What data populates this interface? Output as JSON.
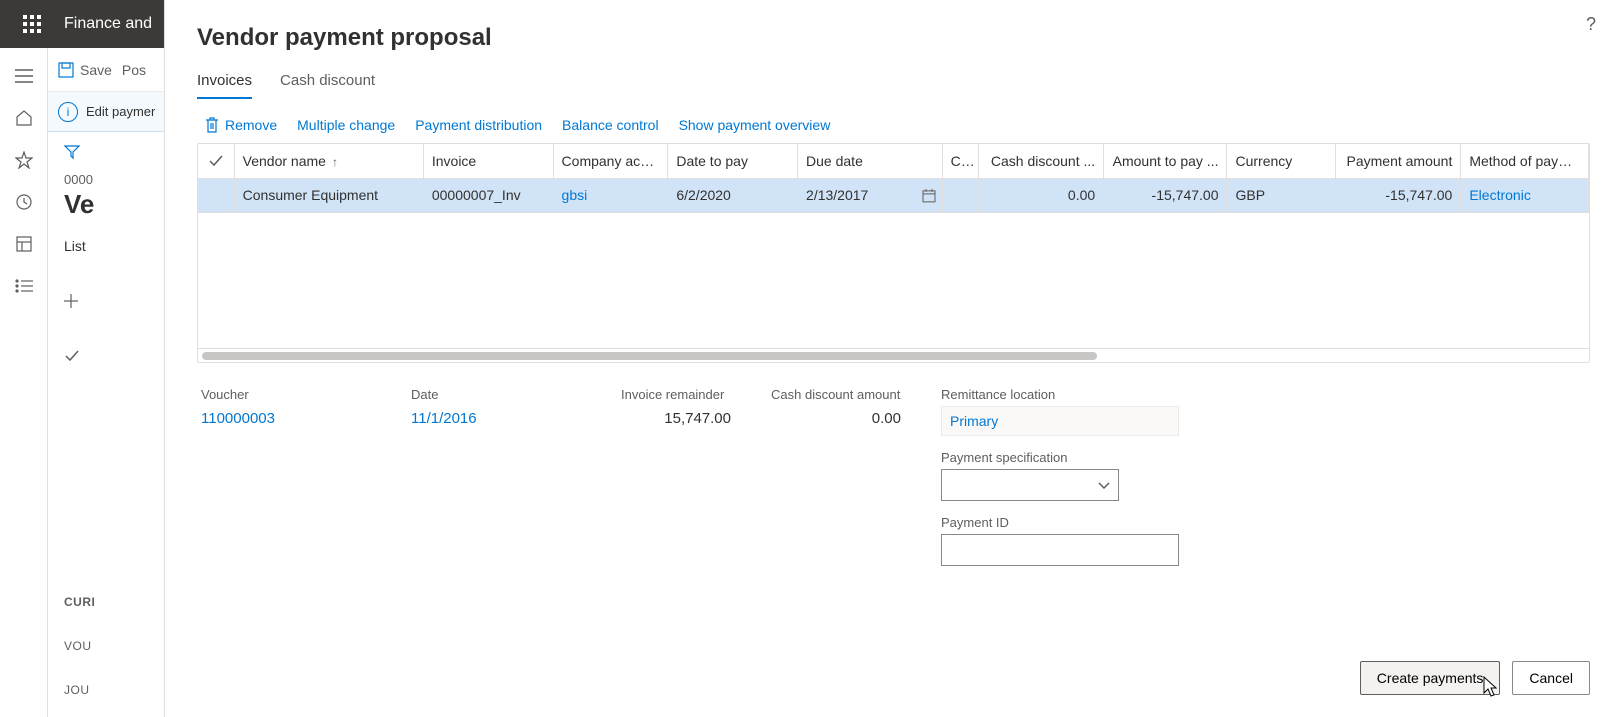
{
  "topbar": {
    "app_title": "Finance and"
  },
  "leftrail": {},
  "bgpage": {
    "save_label": "Save",
    "post_label": "Pos",
    "infobar_text": "Edit paymer",
    "record_num": "0000",
    "heading": "Ve",
    "tab_list": "List",
    "add_label": "",
    "section_current": "CURI",
    "field_voucher": "VOU",
    "field_journal": "JOU"
  },
  "dialog": {
    "title": "Vendor payment proposal",
    "tabs": {
      "invoices": "Invoices",
      "cash_discount": "Cash discount"
    },
    "actions": {
      "remove": "Remove",
      "multiple_change": "Multiple change",
      "payment_distribution": "Payment distribution",
      "balance_control": "Balance control",
      "show_payment_overview": "Show payment overview"
    },
    "grid": {
      "columns": {
        "vendor_name": "Vendor name",
        "invoice": "Invoice",
        "company_account": "Company acco...",
        "date_to_pay": "Date to pay",
        "due_date": "Due date",
        "c": "C...",
        "cash_discount": "Cash discount ...",
        "amount_to_pay": "Amount to pay ...",
        "currency": "Currency",
        "payment_amount": "Payment amount",
        "method_of_payment": "Method of payment"
      },
      "rows": [
        {
          "vendor_name": "Consumer Equipment",
          "invoice": "00000007_Inv",
          "company_account": "gbsi",
          "date_to_pay": "6/2/2020",
          "due_date": "2/13/2017",
          "c": "",
          "cash_discount": "0.00",
          "amount_to_pay": "-15,747.00",
          "currency": "GBP",
          "payment_amount": "-15,747.00",
          "method_of_payment": "Electronic"
        }
      ]
    },
    "details": {
      "voucher_label": "Voucher",
      "voucher_value": "110000003",
      "date_label": "Date",
      "date_value": "11/1/2016",
      "invoice_remainder_label": "Invoice remainder",
      "invoice_remainder_value": "15,747.00",
      "cash_discount_amount_label": "Cash discount amount",
      "cash_discount_amount_value": "0.00",
      "remittance_location_label": "Remittance location",
      "remittance_location_value": "Primary",
      "payment_specification_label": "Payment specification",
      "payment_specification_value": "",
      "payment_id_label": "Payment ID",
      "payment_id_value": ""
    },
    "footer": {
      "create_payments": "Create payments",
      "cancel": "Cancel"
    }
  }
}
